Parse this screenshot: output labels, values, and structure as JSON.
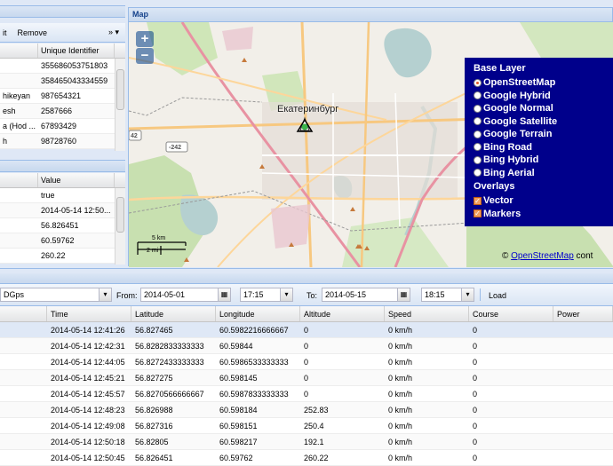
{
  "devices_panel": {
    "toolbar": {
      "edit_label": "it",
      "remove_label": "Remove",
      "more_label": "»"
    },
    "columns": [
      "",
      "Unique Identifier"
    ],
    "rows": [
      {
        "name": "",
        "uid": "355686053751803"
      },
      {
        "name": "",
        "uid": "358465043334559"
      },
      {
        "name": "hikeyan",
        "uid": "987654321"
      },
      {
        "name": "esh",
        "uid": "2587666"
      },
      {
        "name": "a (Hod ...",
        "uid": "67893429"
      },
      {
        "name": "h",
        "uid": "98728760"
      }
    ]
  },
  "state_panel": {
    "columns": [
      "",
      "Value"
    ],
    "rows": [
      {
        "name": "",
        "value": "true"
      },
      {
        "name": "",
        "value": "2014-05-14 12:50..."
      },
      {
        "name": "",
        "value": "56.826451"
      },
      {
        "name": "",
        "value": "60.59762"
      },
      {
        "name": "",
        "value": "260.22"
      }
    ]
  },
  "map_panel": {
    "title": "Map",
    "city_label": "Екатеринбург",
    "road_label": "-242",
    "road_label_left": "42",
    "scale": {
      "top": "5 km",
      "bottom": "2 mi"
    },
    "attribution": {
      "symbol": "©",
      "link": "OpenStreetMap",
      "suffix": " cont"
    },
    "layer_switcher": {
      "base_header": "Base Layer",
      "base_layers": [
        {
          "label": "OpenStreetMap",
          "selected": true
        },
        {
          "label": "Google Hybrid",
          "selected": false
        },
        {
          "label": "Google Normal",
          "selected": false
        },
        {
          "label": "Google Satellite",
          "selected": false
        },
        {
          "label": "Google Terrain",
          "selected": false
        },
        {
          "label": "Bing Road",
          "selected": false
        },
        {
          "label": "Bing Hybrid",
          "selected": false
        },
        {
          "label": "Bing Aerial",
          "selected": false
        }
      ],
      "overlay_header": "Overlays",
      "overlays": [
        {
          "label": "Vector",
          "checked": true
        },
        {
          "label": "Markers",
          "checked": true
        }
      ]
    }
  },
  "report_toolbar": {
    "device_value": "DGps",
    "from_label": "From:",
    "from_date": "2014-05-01",
    "from_time": "17:15",
    "to_label": "To:",
    "to_date": "2014-05-15",
    "to_time": "18:15",
    "load_label": "Load"
  },
  "positions_grid": {
    "columns": [
      "",
      "Time",
      "Latitude",
      "Longitude",
      "Altitude",
      "Speed",
      "Course",
      "Power"
    ],
    "rows": [
      {
        "time": "2014-05-14 12:41:26",
        "lat": "56.827465",
        "lon": "60.5982216666667",
        "alt": "0",
        "speed": "0 km/h",
        "course": "0"
      },
      {
        "time": "2014-05-14 12:42:31",
        "lat": "56.8282833333333",
        "lon": "60.59844",
        "alt": "0",
        "speed": "0 km/h",
        "course": "0"
      },
      {
        "time": "2014-05-14 12:44:05",
        "lat": "56.8272433333333",
        "lon": "60.5986533333333",
        "alt": "0",
        "speed": "0 km/h",
        "course": "0"
      },
      {
        "time": "2014-05-14 12:45:21",
        "lat": "56.827275",
        "lon": "60.598145",
        "alt": "0",
        "speed": "0 km/h",
        "course": "0"
      },
      {
        "time": "2014-05-14 12:45:57",
        "lat": "56.8270566666667",
        "lon": "60.5987833333333",
        "alt": "0",
        "speed": "0 km/h",
        "course": "0"
      },
      {
        "time": "2014-05-14 12:48:23",
        "lat": "56.826988",
        "lon": "60.598184",
        "alt": "252.83",
        "speed": "0 km/h",
        "course": "0"
      },
      {
        "time": "2014-05-14 12:49:08",
        "lat": "56.827316",
        "lon": "60.598151",
        "alt": "250.4",
        "speed": "0 km/h",
        "course": "0"
      },
      {
        "time": "2014-05-14 12:50:18",
        "lat": "56.82805",
        "lon": "60.598217",
        "alt": "192.1",
        "speed": "0 km/h",
        "course": "0"
      },
      {
        "time": "2014-05-14 12:50:45",
        "lat": "56.826451",
        "lon": "60.59762",
        "alt": "260.22",
        "speed": "0 km/h",
        "course": "0"
      }
    ]
  },
  "colors": {
    "accent": "#15428b",
    "layer_bg": "#00008b",
    "selection": "#dfe8f6"
  }
}
